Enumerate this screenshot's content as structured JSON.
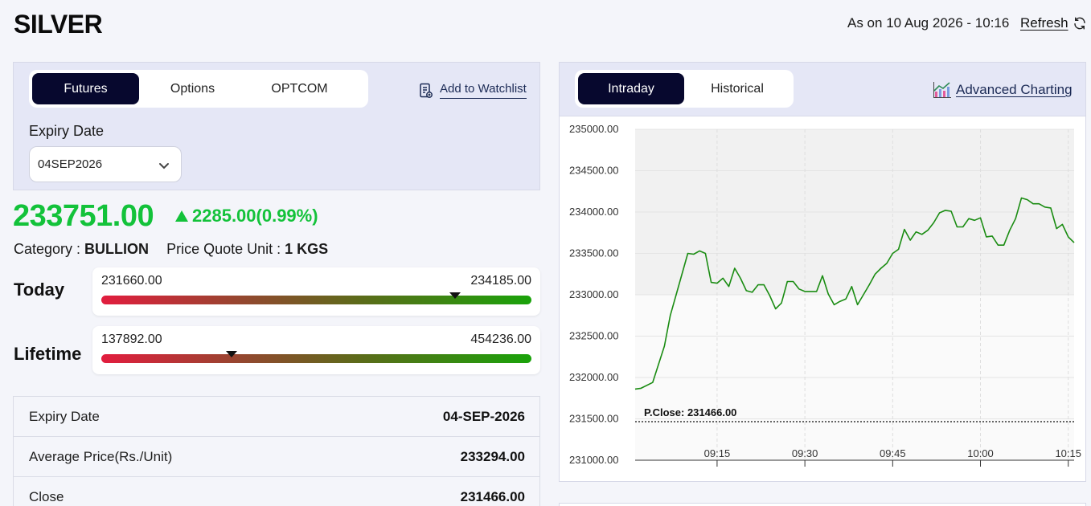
{
  "header": {
    "title": "SILVER",
    "as_on": "As on 10 Aug 2026 - 10:16",
    "refresh_label": "Refresh"
  },
  "contract_tabs": [
    "Futures",
    "Options",
    "OPTCOM"
  ],
  "active_contract_tab": "Futures",
  "watchlist_label": "Add to Watchlist",
  "expiry": {
    "label": "Expiry Date",
    "selected": "04SEP2026"
  },
  "quote": {
    "price": "233751.00",
    "change": "2285.00(0.99%)",
    "category_label": "Category : ",
    "category": "BULLION",
    "unit_label": "Price Quote Unit : ",
    "unit": "1 KGS"
  },
  "ranges": {
    "today": {
      "label": "Today",
      "low": "231660.00",
      "high": "234185.00",
      "position": 0.822
    },
    "lifetime": {
      "label": "Lifetime",
      "low": "137892.00",
      "high": "454236.00",
      "position": 0.303
    }
  },
  "details": [
    {
      "key": "Expiry Date",
      "value": "04-SEP-2026"
    },
    {
      "key": "Average Price(Rs./Unit)",
      "value": "233294.00"
    },
    {
      "key": "Close",
      "value": "231466.00"
    }
  ],
  "chart_tabs": [
    "Intraday",
    "Historical"
  ],
  "active_chart_tab": "Intraday",
  "advanced_label": "Advanced Charting",
  "colors": {
    "up": "#13c23a",
    "line": "#1a8c12",
    "dark": "#07082e"
  },
  "chart_data": {
    "type": "line",
    "ylim": [
      231000,
      235000
    ],
    "y_ticks": [
      "235000.00",
      "234500.00",
      "234000.00",
      "233500.00",
      "233000.00",
      "232500.00",
      "232000.00",
      "231500.00",
      "231000.00"
    ],
    "x_ticks": [
      "09:15",
      "09:30",
      "09:45",
      "10:00",
      "10:15"
    ],
    "previous_close": 231466,
    "previous_close_label": "P.Close: 231466.00",
    "series": [
      {
        "times": [
          "09:01",
          "09:02",
          "09:04",
          "09:06",
          "09:07",
          "09:08",
          "09:10",
          "09:11",
          "09:12",
          "09:13",
          "09:14",
          "09:15",
          "09:16",
          "09:17",
          "09:18",
          "09:19",
          "09:20",
          "09:21",
          "09:22",
          "09:23",
          "09:24",
          "09:25",
          "09:26",
          "09:27",
          "09:28",
          "09:29",
          "09:30",
          "09:31",
          "09:32",
          "09:33",
          "09:34",
          "09:35",
          "09:36",
          "09:37",
          "09:38",
          "09:39",
          "09:40",
          "09:41",
          "09:42",
          "09:43",
          "09:44",
          "09:45",
          "09:46",
          "09:47",
          "09:48",
          "09:49",
          "09:50",
          "09:51",
          "09:52",
          "09:53",
          "09:54",
          "09:55",
          "09:56",
          "09:57",
          "09:58",
          "09:59",
          "10:00",
          "10:01",
          "10:02",
          "10:03",
          "10:04",
          "10:05",
          "10:06",
          "10:07",
          "10:08",
          "10:09",
          "10:10",
          "10:11",
          "10:12",
          "10:13",
          "10:14",
          "10:15",
          "10:16"
        ],
        "values": [
          231860,
          231870,
          231940,
          232380,
          232750,
          233000,
          233500,
          233490,
          233530,
          233500,
          233150,
          233140,
          233200,
          233100,
          233320,
          233200,
          233050,
          233030,
          233120,
          233120,
          232990,
          232830,
          232900,
          233160,
          233160,
          233070,
          233040,
          233040,
          233040,
          233230,
          233010,
          232880,
          232920,
          232950,
          233100,
          232880,
          233000,
          233120,
          233250,
          233320,
          233380,
          233500,
          233550,
          233790,
          233660,
          233760,
          233730,
          233780,
          233870,
          233990,
          234020,
          234010,
          233820,
          233820,
          233920,
          233900,
          233930,
          233700,
          233710,
          233600,
          233600,
          233780,
          233920,
          234170,
          234150,
          234100,
          234100,
          234060,
          234050,
          233800,
          233850,
          233700,
          233630,
          233740,
          233700
        ]
      }
    ]
  }
}
